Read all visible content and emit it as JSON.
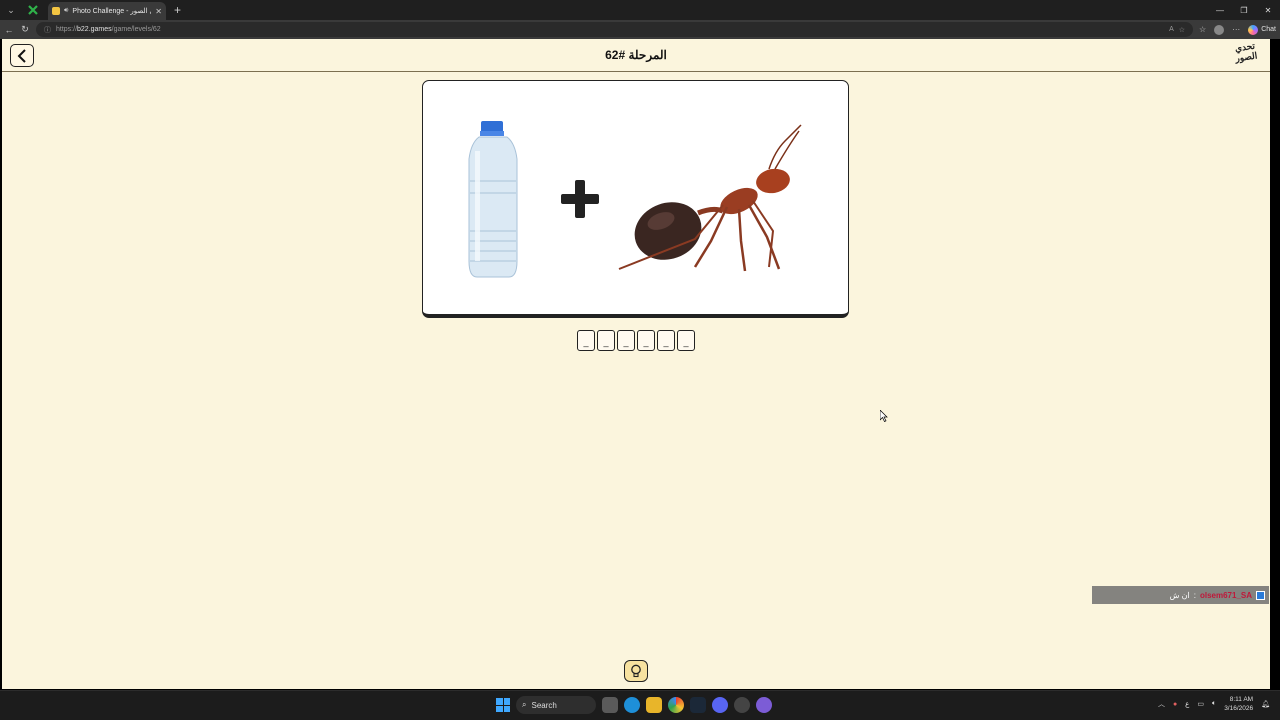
{
  "browser": {
    "tab_title": "Photo Challenge - تحدي الصور",
    "url_domain": "b22.games",
    "url_path": "/game/levels/62",
    "url_prefix": "https://",
    "chat_label": "Chat"
  },
  "header": {
    "level_title": "المرحلة #62",
    "logo_text_line1": "تحدي",
    "logo_text_line2": "الصور"
  },
  "puzzle": {
    "images": [
      "water-bottle",
      "plus-sign",
      "ant"
    ],
    "slots": [
      "_",
      "_",
      "_",
      "_",
      "_",
      "_"
    ]
  },
  "chat_overlay": {
    "username": "olsem671_SA",
    "message": "ان ش"
  },
  "taskbar": {
    "search_label": "Search",
    "time": "8:11 AM",
    "date": "3/16/2026"
  }
}
